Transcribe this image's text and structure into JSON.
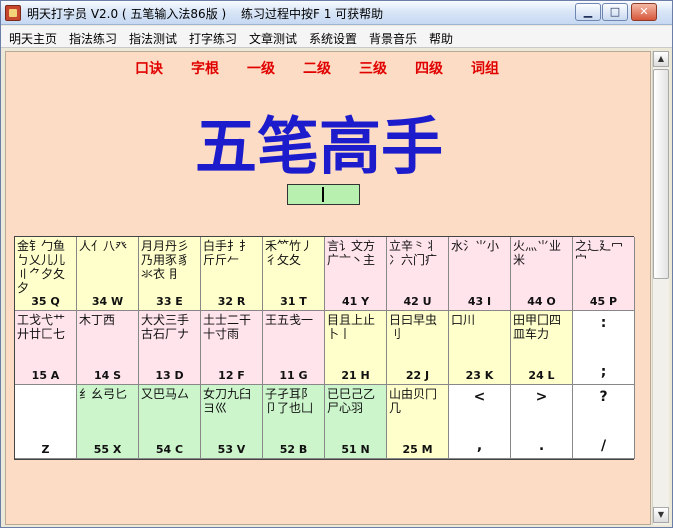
{
  "window": {
    "title": "明天打字员 V2.0 ( 五笔输入法86版 )",
    "tip": "练习过程中按F 1 可获帮助",
    "controls": {
      "minimize": "▁",
      "maximize": "□",
      "close": "✕"
    }
  },
  "menu": [
    "明天主页",
    "指法练习",
    "指法测试",
    "打字练习",
    "文章测试",
    "系统设置",
    "背景音乐",
    "帮助"
  ],
  "nav": [
    "口诀",
    "字根",
    "一级",
    "二级",
    "三级",
    "四级",
    "词组"
  ],
  "big_title": "五笔高手",
  "colors": {
    "background": "#fcdcc4",
    "key_yellow": "#ffffcc",
    "key_pink": "#ffe4ec",
    "key_green": "#ccf5cc",
    "key_white": "#ffffff",
    "nav": "#e00000",
    "title": "#1c1ccc"
  },
  "keyboard": {
    "row1": [
      {
        "roots": "金钅勹鱼ㄅ乂儿儿〢⺈夕夂夕",
        "code": "35 Q",
        "color": "key_yellow"
      },
      {
        "roots": "人亻八癶",
        "code": "34 W",
        "color": "key_yellow"
      },
      {
        "roots": "月月丹彡乃用豕豸氺衣 ⺝",
        "code": "33 E",
        "color": "key_yellow"
      },
      {
        "roots": "白手扌⺘斤斤𠂉",
        "code": "32 R",
        "color": "key_yellow"
      },
      {
        "roots": "禾⺮竹丿彳攵夂",
        "code": "31 T",
        "color": "key_yellow"
      },
      {
        "roots": "言讠文方广亠丶主",
        "code": "41 Y",
        "color": "key_pink"
      },
      {
        "roots": "立辛⺀丬冫六门疒",
        "code": "42 U",
        "color": "key_pink"
      },
      {
        "roots": "水氵⺌小",
        "code": "43 I",
        "color": "key_pink"
      },
      {
        "roots": "火灬⺌业米",
        "code": "44 O",
        "color": "key_pink"
      },
      {
        "roots": "之辶廴冖宀",
        "code": "45 P",
        "color": "key_pink"
      }
    ],
    "row2": [
      {
        "roots": "工戈弋艹廾廿匚七",
        "code": "15 A",
        "color": "key_pink"
      },
      {
        "roots": "木丁西",
        "code": "14 S",
        "color": "key_pink"
      },
      {
        "roots": "大犬三手古石厂ナ",
        "code": "13 D",
        "color": "key_pink"
      },
      {
        "roots": "土士二干十寸雨",
        "code": "12 F",
        "color": "key_pink"
      },
      {
        "roots": "王五戋一",
        "code": "11 G",
        "color": "key_pink"
      },
      {
        "roots": "目且上止卜丨",
        "code": "21 H",
        "color": "key_yellow"
      },
      {
        "roots": "日曰早虫刂",
        "code": "22 J",
        "color": "key_yellow"
      },
      {
        "roots": "口川",
        "code": "23 K",
        "color": "key_yellow"
      },
      {
        "roots": "田甲囗四皿车力",
        "code": "24 L",
        "color": "key_yellow"
      },
      {
        "sym_top": ":",
        "sym_bottom": ";",
        "color": "key_white"
      }
    ],
    "row3": [
      {
        "roots": "",
        "code": "Z",
        "color": "key_white"
      },
      {
        "roots": "纟幺弓匕",
        "code": "55 X",
        "color": "key_green"
      },
      {
        "roots": "又巴马厶",
        "code": "54 C",
        "color": "key_green"
      },
      {
        "roots": "女刀九臼ヨ巛",
        "code": "53 V",
        "color": "key_green"
      },
      {
        "roots": "子孑耳阝卩了也凵",
        "code": "52 B",
        "color": "key_green"
      },
      {
        "roots": "已巳己乙尸心羽",
        "code": "51 N",
        "color": "key_green"
      },
      {
        "roots": "山由贝冂几",
        "code": "25 M",
        "color": "key_yellow"
      },
      {
        "sym_top": "<",
        "sym_bottom": ",",
        "color": "key_white"
      },
      {
        "sym_top": ">",
        "sym_bottom": ".",
        "color": "key_white"
      },
      {
        "sym_top": "?",
        "sym_bottom": "/",
        "color": "key_white"
      }
    ]
  }
}
